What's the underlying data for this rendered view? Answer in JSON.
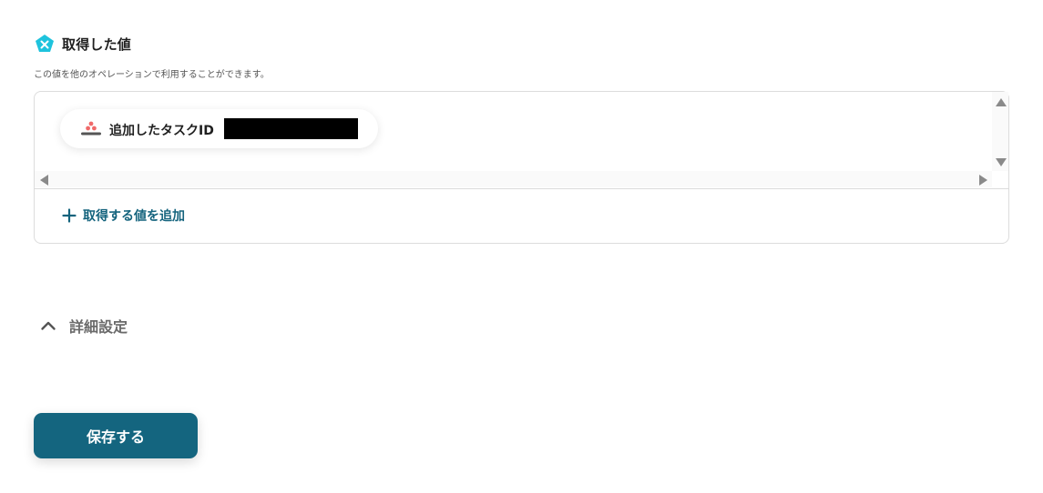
{
  "section": {
    "icon": "pentagon-x-icon",
    "title": "取得した値",
    "description": "この値を他のオペレーションで利用することができます。"
  },
  "values": [
    {
      "app_icon": "asana-logo",
      "label": "追加したタスクID",
      "value": ""
    }
  ],
  "add_value": {
    "icon": "plus-icon",
    "label": "取得する値を追加"
  },
  "advanced": {
    "icon": "chevron-up-icon",
    "label": "詳細設定",
    "expanded": true
  },
  "save_button": {
    "label": "保存する"
  },
  "colors": {
    "accent": "#14657f",
    "icon_cyan": "#1ec3dd",
    "asana_red": "#f06a6a",
    "border": "#dcdcdc"
  }
}
